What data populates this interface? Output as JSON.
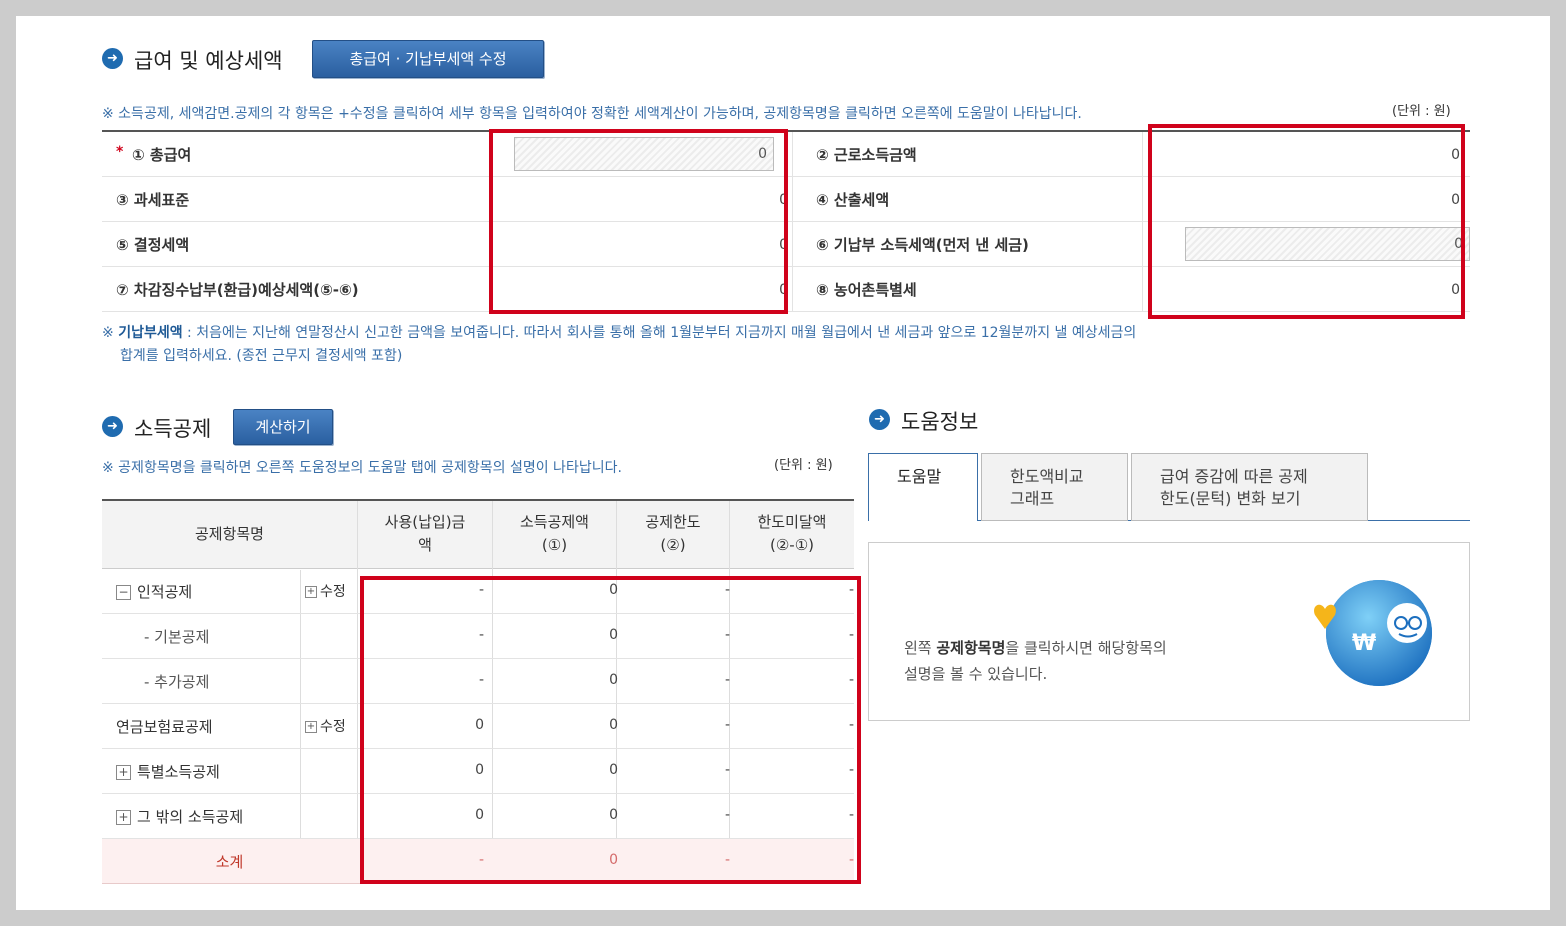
{
  "salary_section": {
    "title": "급여 및 예상세액",
    "edit_button": "총급여 · 기납부세액 수정",
    "note": "※ 소득공제, 세액감면.공제의 각 항목은 +수정을 클릭하여 세부 항목을 입력하여야 정확한 세액계산이 가능하며, 공제항목명을 클릭하면 오른쪽에 도움말이 나타납니다.",
    "unit": "(단위 : 원)",
    "required_mark": "*",
    "rows": [
      {
        "left_label": "① 총급여",
        "left_value": "0",
        "right_label": "② 근로소득금액",
        "right_value": "0"
      },
      {
        "left_label": "③ 과세표준",
        "left_value": "0",
        "right_label": "④ 산출세액",
        "right_value": "0"
      },
      {
        "left_label": "⑤ 결정세액",
        "left_value": "0",
        "right_label": "⑥ 기납부 소득세액(먼저 낸 세금)",
        "right_value": "0"
      },
      {
        "left_label": "⑦ 차감징수납부(환급)예상세액(⑤-⑥)",
        "left_value": "0",
        "right_label": "⑧ 농어촌특별세",
        "right_value": "0"
      }
    ],
    "footnote_mark": "※",
    "footnote_bold": "기납부세액",
    "footnote_line1": " : 처음에는 지난해 연말정산시 신고한 금액을 보여줍니다. 따라서 회사를 통해 올해 1월분부터 지금까지 매월 월급에서 낸 세금과 앞으로 12월분까지 낼 예상세금의",
    "footnote_line2": "합계를 입력하세요. (종전 근무지 결정세액 포함)"
  },
  "deduction_section": {
    "title": "소득공제",
    "calc_button": "계산하기",
    "note": "※ 공제항목명을 클릭하면 오른쪽 도움정보의 도움말 탭에 공제항목의 설명이 나타납니다.",
    "unit": "(단위 : 원)",
    "headers": {
      "name": "공제항목명",
      "used_1": "사용(납입)금",
      "used_2": "액",
      "amount_1": "소득공제액",
      "amount_2": "(①)",
      "limit_1": "공제한도",
      "limit_2": "(②)",
      "under_1": "한도미달액",
      "under_2": "(②-①)"
    },
    "edit_label": "수정",
    "rows": [
      {
        "toggle": "−",
        "label": "인적공제",
        "used": "-",
        "amount": "0",
        "limit": "-",
        "under": "-"
      },
      {
        "label": "- 기본공제",
        "used": "-",
        "amount": "0",
        "limit": "-",
        "under": "-"
      },
      {
        "label": "- 추가공제",
        "used": "-",
        "amount": "0",
        "limit": "-",
        "under": "-"
      },
      {
        "label": "연금보험료공제",
        "used": "0",
        "amount": "0",
        "limit": "-",
        "under": "-"
      },
      {
        "toggle": "+",
        "label": "특별소득공제",
        "used": "0",
        "amount": "0",
        "limit": "-",
        "under": "-"
      },
      {
        "toggle": "+",
        "label": "그 밖의 소득공제",
        "used": "0",
        "amount": "0",
        "limit": "-",
        "under": "-"
      }
    ],
    "subtotal": {
      "label": "소계",
      "used": "-",
      "amount": "0",
      "limit": "-",
      "under": "-"
    }
  },
  "help_section": {
    "title": "도움정보",
    "tabs": [
      {
        "line1": "도움말",
        "line2": ""
      },
      {
        "line1": "한도액비교",
        "line2": "그래프"
      },
      {
        "line1": "급여 증감에 따른 공제",
        "line2": "한도(문턱) 변화 보기"
      }
    ],
    "text_pre": "왼쪽 ",
    "text_bold": "공제항목명",
    "text_post": "을 클릭하시면 해당항목의",
    "text_line2": "설명을 볼 수 있습니다.",
    "mascot_symbol": "₩",
    "mascot_icon": "coin-mascot-icon"
  },
  "colors": {
    "accent": "#1f6bb0",
    "highlight": "#d0021b",
    "subtotal_bg": "#fdf0f0"
  }
}
